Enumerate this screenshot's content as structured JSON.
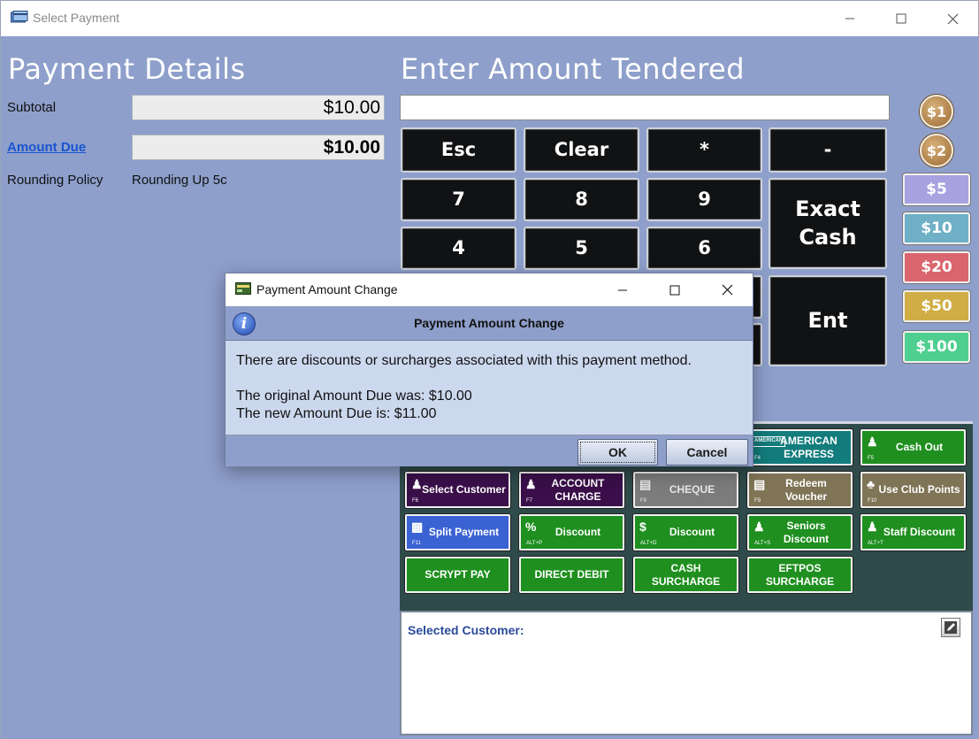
{
  "window": {
    "title": "Select Payment"
  },
  "payment_details": {
    "heading": "Payment Details",
    "subtotal_label": "Subtotal",
    "subtotal_value": "$10.00",
    "amount_due_label": "Amount Due",
    "amount_due_value": "$10.00",
    "rounding_label": "Rounding Policy",
    "rounding_value": "Rounding Up 5c"
  },
  "tender": {
    "heading": "Enter Amount Tendered",
    "input_value": "",
    "keys": {
      "esc": "Esc",
      "clear": "Clear",
      "multiply": "*",
      "minus": "-",
      "k7": "7",
      "k8": "8",
      "k9": "9",
      "k4": "4",
      "k5": "5",
      "k6": "6",
      "exact_line1": "Exact",
      "exact_line2": "Cash",
      "enter": "Ent"
    },
    "coins": [
      "$1",
      "$2"
    ],
    "notes": [
      "$5",
      "$10",
      "$20",
      "$50",
      "$100"
    ]
  },
  "colors": {
    "note_5": "#a9a2e0",
    "note_10": "#6fb0c7",
    "note_20": "#d9656e",
    "note_50": "#d1ad45",
    "note_100": "#4fcf8f"
  },
  "payment_methods": {
    "amex_line1": "AMERICAN",
    "amex_line2": "EXPRESS",
    "amex_key": "F4",
    "amex_icon_text": "AMERICAN",
    "cash_out": "Cash Out",
    "cash_out_key": "F5",
    "select_customer": "Select Customer",
    "select_customer_key": "F6",
    "account_line1": "ACCOUNT",
    "account_line2": "CHARGE",
    "account_key": "F7",
    "cheque": "CHEQUE",
    "cheque_key": "F8",
    "redeem_line1": "Redeem",
    "redeem_line2": "Voucher",
    "redeem_key": "F9",
    "club_points": "Use Club Points",
    "club_points_key": "F10",
    "split_payment": "Split Payment",
    "split_payment_key": "F11",
    "discount_pct": "Discount",
    "discount_pct_key": "ALT+P",
    "discount_dollar": "Discount",
    "discount_dollar_key": "ALT+D",
    "seniors_line1": "Seniors",
    "seniors_line2": "Discount",
    "seniors_key": "ALT+S",
    "staff_discount": "Staff Discount",
    "staff_discount_key": "ALT+T",
    "scrypt_pay": "SCRYPT PAY",
    "direct_debit": "DIRECT DEBIT",
    "cash_surcharge_line1": "CASH",
    "cash_surcharge_line2": "SURCHARGE",
    "eftpos_line1": "EFTPOS",
    "eftpos_line2": "SURCHARGE"
  },
  "customer": {
    "label": "Selected Customer:"
  },
  "dialog": {
    "title": "Payment Amount Change",
    "heading": "Payment Amount Change",
    "message1": "There are discounts or surcharges associated with this payment method.",
    "message2": "The original Amount Due was: $10.00",
    "message3": "The new Amount Due is: $11.00",
    "ok": "OK",
    "cancel": "Cancel"
  }
}
